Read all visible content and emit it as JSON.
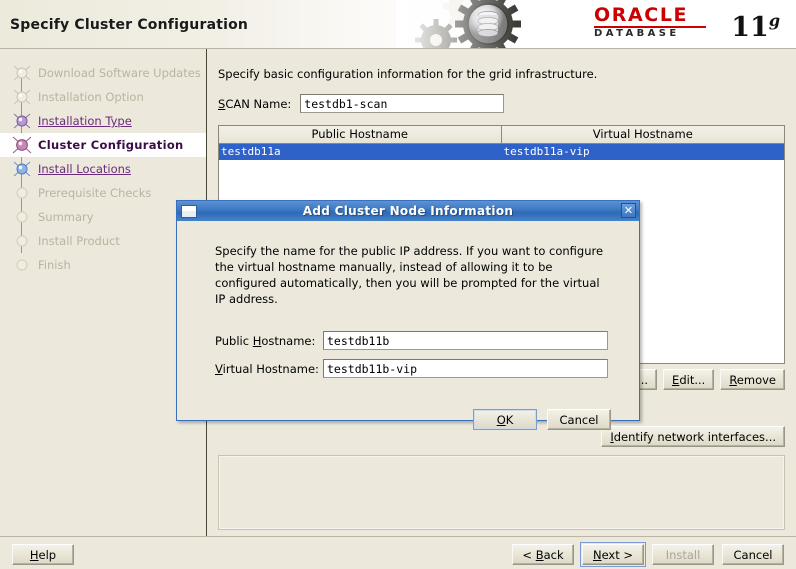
{
  "header": {
    "title": "Specify Cluster Configuration",
    "logo": {
      "brand": "ORACLE",
      "brand_mark": "®",
      "product": "DATABASE",
      "version": "11",
      "version_sup": "g",
      "brand_color": "#cc0000"
    },
    "art_icon": "gears-and-database-cylinder-icon"
  },
  "sidebar": {
    "items": [
      {
        "label": "Download Software Updates",
        "state": "done"
      },
      {
        "label": "Installation Option",
        "state": "done"
      },
      {
        "label": "Installation Type",
        "state": "link"
      },
      {
        "label": "Cluster Configuration",
        "state": "current"
      },
      {
        "label": "Install Locations",
        "state": "link"
      },
      {
        "label": "Prerequisite Checks",
        "state": "pending"
      },
      {
        "label": "Summary",
        "state": "pending"
      },
      {
        "label": "Install Product",
        "state": "pending"
      },
      {
        "label": "Finish",
        "state": "pending"
      }
    ]
  },
  "main": {
    "intro": "Specify basic configuration information for the grid infrastructure.",
    "scan": {
      "label": "SCAN Name:",
      "label_mnemonic": "S",
      "value": "testdb1-scan"
    },
    "table": {
      "columns": [
        "Public Hostname",
        "Virtual Hostname"
      ],
      "rows": [
        {
          "public": "testdb11a",
          "virtual": "testdb11a-vip",
          "selected": true
        }
      ]
    },
    "buttons": {
      "add": "Add...",
      "add_mnemonic": "A",
      "edit": "Edit...",
      "edit_mnemonic": "E",
      "remove": "Remove",
      "remove_mnemonic": "R",
      "identify": "Identify network interfaces...",
      "identify_mnemonic": "I"
    }
  },
  "dialog": {
    "title": "Add Cluster Node Information",
    "window_icon": "window-icon",
    "close_icon": "✕",
    "description": "Specify the name for the public IP address. If you want to configure the virtual hostname manually, instead of allowing it to be configured automatically, then you will be prompted for the virtual IP address.",
    "fields": [
      {
        "label": "Public Hostname:",
        "mnemonic": "H",
        "value": "testdb11b"
      },
      {
        "label": "Virtual Hostname:",
        "mnemonic": "V",
        "value": "testdb11b-vip"
      }
    ],
    "ok": "OK",
    "ok_mnemonic": "O",
    "cancel": "Cancel"
  },
  "bottom": {
    "help": "Help",
    "help_mnemonic": "H",
    "back": "< Back",
    "back_mnemonic": "B",
    "next": "Next >",
    "next_mnemonic": "N",
    "install": "Install",
    "install_disabled": true,
    "cancel": "Cancel"
  },
  "colors": {
    "background": "#ece9dc",
    "selection_blue": "#2f62c9",
    "title_blue": "#3f7ac4",
    "link_purple": "#6a2b7a",
    "accent_red": "#cc0000"
  }
}
